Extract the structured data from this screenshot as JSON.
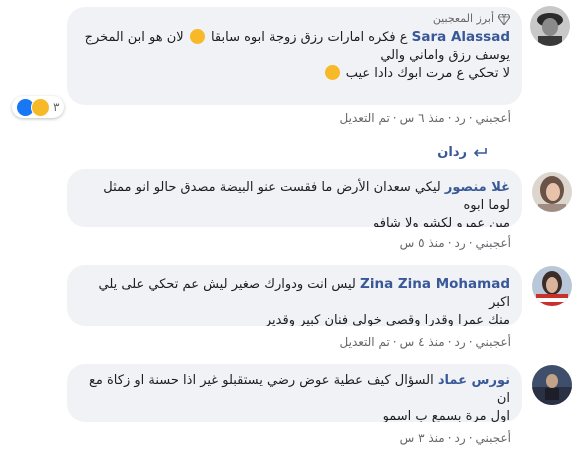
{
  "comments": [
    {
      "author": "Sara Alassad",
      "badge": "أبرز المعجبين",
      "lines": [
        "ع فكره امارات رزق زوجة ابوه سابقا",
        "لان هو ابن المخرج",
        "يوسف رزق واماني والي",
        "لا تحكي ع مرت ابوك دادا عيب"
      ],
      "actions": {
        "like": "أعجبني",
        "reply": "رد",
        "time": "منذ ٦ س",
        "edited": "تم التعديل"
      },
      "reactions": {
        "count": "٣",
        "icons": [
          "like-reaction-icon",
          "haha-reaction-icon"
        ]
      }
    },
    {
      "author": "غلا منصور",
      "lines": [
        "ليكي سعدان الأرض ما فقست عنو البيضة مصدق حالو انو ممثل لوما ابوه",
        "مين عمرو لكشو ولا شافو"
      ],
      "actions": {
        "like": "أعجبني",
        "reply": "رد",
        "time": "منذ ٥ س"
      }
    },
    {
      "author": "Zina Zina Mohamad",
      "lines": [
        "ليس انت ودوارك صغير ليش عم تحكي على يلي اكبر",
        "منك عمرا وقدرا وقصي خولي فنان كبير وقدير"
      ],
      "actions": {
        "like": "أعجبني",
        "reply": "رد",
        "time": "منذ ٤ س",
        "edited": "تم التعديل"
      }
    },
    {
      "author": "نورس عماد",
      "lines": [
        "السؤال كيف عطية عوض رضي يستقبلو غير اذا حسنة او زكاة مع ان",
        "اول مرة بسمع ب اسمو"
      ],
      "actions": {
        "like": "أعجبني",
        "reply": "رد",
        "time": "منذ ٣ س"
      }
    }
  ],
  "replies_label": "ردان",
  "colors": {
    "link": "#385898",
    "bubble": "#f0f2f5",
    "meta": "#65676b",
    "like_blue": "#1877f2",
    "haha_yellow": "#f7b928"
  }
}
